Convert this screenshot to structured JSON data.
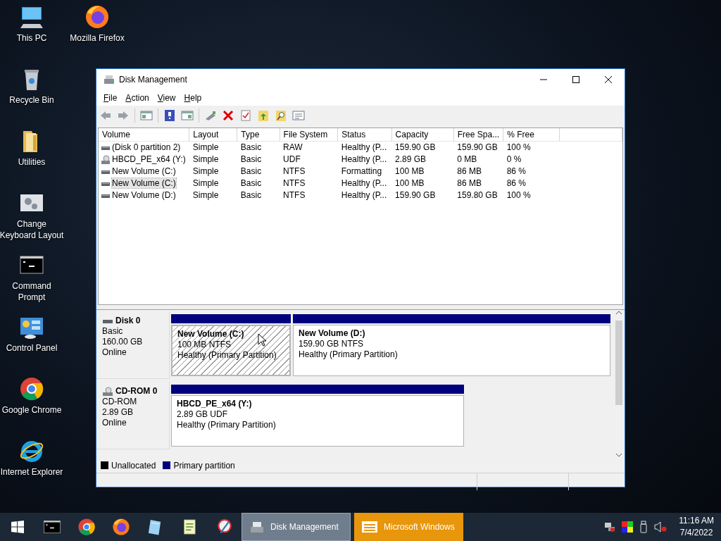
{
  "desktop": {
    "icons": [
      {
        "label": "This PC",
        "kind": "computer"
      },
      {
        "label": "Mozilla Firefox",
        "kind": "firefox"
      },
      {
        "label": "Recycle Bin",
        "kind": "bin"
      },
      {
        "label": "Utilities",
        "kind": "folder"
      },
      {
        "label": "Change Keyboard Layout",
        "kind": "settings"
      },
      {
        "label": "Command Prompt",
        "kind": "console"
      },
      {
        "label": "Control Panel",
        "kind": "panel"
      },
      {
        "label": "Google Chrome",
        "kind": "chrome"
      },
      {
        "label": "Internet Explorer",
        "kind": "ie"
      }
    ]
  },
  "window": {
    "title": "Disk Management",
    "menu": [
      "File",
      "Action",
      "View",
      "Help"
    ],
    "table": {
      "columns": [
        "Volume",
        "Layout",
        "Type",
        "File System",
        "Status",
        "Capacity",
        "Free Spa...",
        "% Free"
      ],
      "rows": [
        {
          "kind": "disk",
          "selected": false,
          "cells": [
            "(Disk 0 partition 2)",
            "Simple",
            "Basic",
            "RAW",
            "Healthy (P...",
            "159.90 GB",
            "159.90 GB",
            "100 %"
          ]
        },
        {
          "kind": "cdrom",
          "selected": false,
          "cells": [
            "HBCD_PE_x64 (Y:)",
            "Simple",
            "Basic",
            "UDF",
            "Healthy (P...",
            "2.89 GB",
            "0 MB",
            "0 %"
          ]
        },
        {
          "kind": "disk",
          "selected": false,
          "cells": [
            "New Volume (C:)",
            "Simple",
            "Basic",
            "NTFS",
            "Formatting",
            "100 MB",
            "86 MB",
            "86 %"
          ]
        },
        {
          "kind": "disk",
          "selected": true,
          "cells": [
            "New Volume (C:)",
            "Simple",
            "Basic",
            "NTFS",
            "Healthy (P...",
            "100 MB",
            "86 MB",
            "86 %"
          ]
        },
        {
          "kind": "disk",
          "selected": false,
          "cells": [
            "New Volume (D:)",
            "Simple",
            "Basic",
            "NTFS",
            "Healthy (P...",
            "159.90 GB",
            "159.80 GB",
            "100 %"
          ]
        }
      ]
    },
    "disks": [
      {
        "kind": "disk",
        "name": "Disk 0",
        "type": "Basic",
        "size": "160.00 GB",
        "status": "Online",
        "partitions": [
          {
            "title": "New Volume  (C:)",
            "detail": "100 MB NTFS",
            "health": "Healthy (Primary Partition)",
            "selected": true
          },
          {
            "title": "New Volume  (D:)",
            "detail": "159.90 GB NTFS",
            "health": "Healthy (Primary Partition)",
            "selected": false
          }
        ]
      },
      {
        "kind": "cdrom",
        "name": "CD-ROM 0",
        "type": "CD-ROM",
        "size": "2.89 GB",
        "status": "Online",
        "partitions": [
          {
            "title": "HBCD_PE_x64  (Y:)",
            "detail": "2.89 GB UDF",
            "health": "Healthy (Primary Partition)",
            "selected": false
          }
        ]
      }
    ],
    "legend": [
      {
        "label": "Unallocated",
        "color": "#000000"
      },
      {
        "label": "Primary partition",
        "color": "#00007f"
      }
    ]
  },
  "taskbar": {
    "pinned": [
      {
        "kind": "console"
      },
      {
        "kind": "chrome"
      },
      {
        "kind": "firefox"
      },
      {
        "kind": "notepad"
      },
      {
        "kind": "editor"
      },
      {
        "kind": "tool"
      }
    ],
    "tasks": [
      {
        "label": "Disk Management",
        "kind": "disk",
        "selected": true,
        "flashing": false
      },
      {
        "label": "Microsoft Windows",
        "kind": "window",
        "selected": false,
        "flashing": true
      }
    ],
    "clock": {
      "time": "11:16 AM",
      "date": "7/4/2022"
    }
  }
}
